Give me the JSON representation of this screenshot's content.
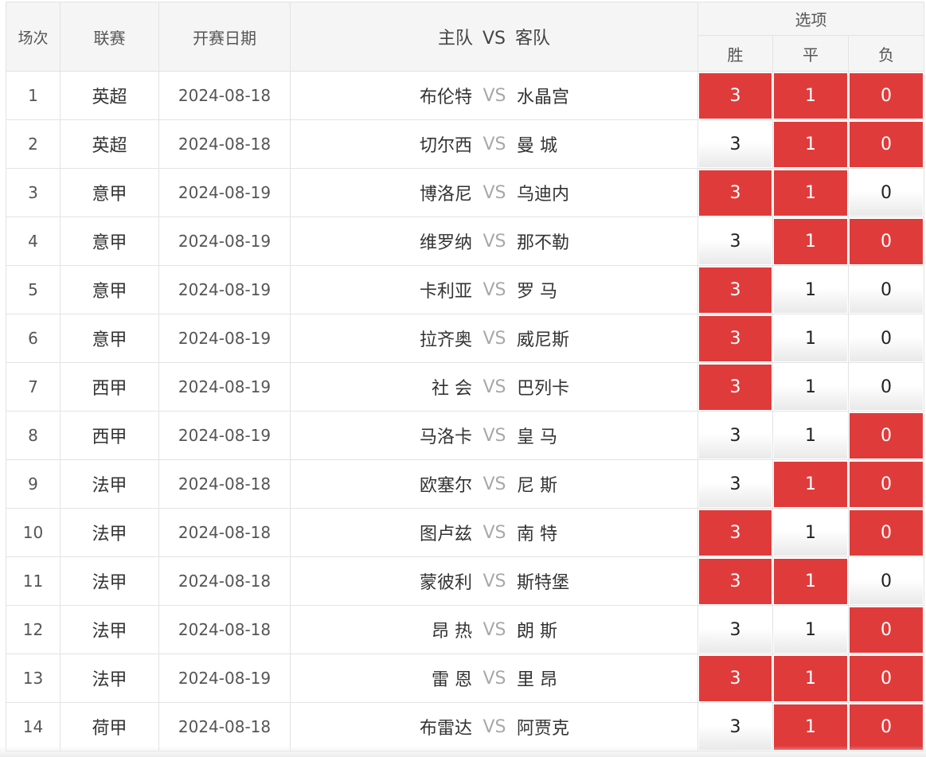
{
  "header": {
    "col_index": "场次",
    "col_league": "联赛",
    "col_date": "开赛日期",
    "col_home": "主队",
    "col_vs": "VS",
    "col_away": "客队",
    "col_options": "选项",
    "opt_win": "胜",
    "opt_draw": "平",
    "opt_lose": "负"
  },
  "colors": {
    "selected": "#e03b3b",
    "vs_text": "#a8a8a8"
  },
  "rows": [
    {
      "no": "1",
      "league": "英超",
      "date": "2024-08-18",
      "home": "布伦特",
      "vs": "VS",
      "away": "水晶宫",
      "win": {
        "label": "3",
        "selected": true
      },
      "draw": {
        "label": "1",
        "selected": true
      },
      "lose": {
        "label": "0",
        "selected": true
      }
    },
    {
      "no": "2",
      "league": "英超",
      "date": "2024-08-18",
      "home": "切尔西",
      "vs": "VS",
      "away": "曼 城",
      "win": {
        "label": "3",
        "selected": false
      },
      "draw": {
        "label": "1",
        "selected": true
      },
      "lose": {
        "label": "0",
        "selected": true
      }
    },
    {
      "no": "3",
      "league": "意甲",
      "date": "2024-08-19",
      "home": "博洛尼",
      "vs": "VS",
      "away": "乌迪内",
      "win": {
        "label": "3",
        "selected": true
      },
      "draw": {
        "label": "1",
        "selected": true
      },
      "lose": {
        "label": "0",
        "selected": false
      }
    },
    {
      "no": "4",
      "league": "意甲",
      "date": "2024-08-19",
      "home": "维罗纳",
      "vs": "VS",
      "away": "那不勒",
      "win": {
        "label": "3",
        "selected": false
      },
      "draw": {
        "label": "1",
        "selected": true
      },
      "lose": {
        "label": "0",
        "selected": true
      }
    },
    {
      "no": "5",
      "league": "意甲",
      "date": "2024-08-19",
      "home": "卡利亚",
      "vs": "VS",
      "away": "罗 马",
      "win": {
        "label": "3",
        "selected": true
      },
      "draw": {
        "label": "1",
        "selected": false
      },
      "lose": {
        "label": "0",
        "selected": false
      }
    },
    {
      "no": "6",
      "league": "意甲",
      "date": "2024-08-19",
      "home": "拉齐奥",
      "vs": "VS",
      "away": "威尼斯",
      "win": {
        "label": "3",
        "selected": true
      },
      "draw": {
        "label": "1",
        "selected": false
      },
      "lose": {
        "label": "0",
        "selected": false
      }
    },
    {
      "no": "7",
      "league": "西甲",
      "date": "2024-08-19",
      "home": "社 会",
      "vs": "VS",
      "away": "巴列卡",
      "win": {
        "label": "3",
        "selected": true
      },
      "draw": {
        "label": "1",
        "selected": false
      },
      "lose": {
        "label": "0",
        "selected": false
      }
    },
    {
      "no": "8",
      "league": "西甲",
      "date": "2024-08-19",
      "home": "马洛卡",
      "vs": "VS",
      "away": "皇 马",
      "win": {
        "label": "3",
        "selected": false
      },
      "draw": {
        "label": "1",
        "selected": false
      },
      "lose": {
        "label": "0",
        "selected": true
      }
    },
    {
      "no": "9",
      "league": "法甲",
      "date": "2024-08-18",
      "home": "欧塞尔",
      "vs": "VS",
      "away": "尼 斯",
      "win": {
        "label": "3",
        "selected": false
      },
      "draw": {
        "label": "1",
        "selected": true
      },
      "lose": {
        "label": "0",
        "selected": true
      }
    },
    {
      "no": "10",
      "league": "法甲",
      "date": "2024-08-18",
      "home": "图卢兹",
      "vs": "VS",
      "away": "南 特",
      "win": {
        "label": "3",
        "selected": true
      },
      "draw": {
        "label": "1",
        "selected": false
      },
      "lose": {
        "label": "0",
        "selected": true
      }
    },
    {
      "no": "11",
      "league": "法甲",
      "date": "2024-08-18",
      "home": "蒙彼利",
      "vs": "VS",
      "away": "斯特堡",
      "win": {
        "label": "3",
        "selected": true
      },
      "draw": {
        "label": "1",
        "selected": true
      },
      "lose": {
        "label": "0",
        "selected": false
      }
    },
    {
      "no": "12",
      "league": "法甲",
      "date": "2024-08-18",
      "home": "昂 热",
      "vs": "VS",
      "away": "朗 斯",
      "win": {
        "label": "3",
        "selected": false
      },
      "draw": {
        "label": "1",
        "selected": false
      },
      "lose": {
        "label": "0",
        "selected": true
      }
    },
    {
      "no": "13",
      "league": "法甲",
      "date": "2024-08-19",
      "home": "雷 恩",
      "vs": "VS",
      "away": "里 昂",
      "win": {
        "label": "3",
        "selected": true
      },
      "draw": {
        "label": "1",
        "selected": true
      },
      "lose": {
        "label": "0",
        "selected": true
      }
    },
    {
      "no": "14",
      "league": "荷甲",
      "date": "2024-08-18",
      "home": "布雷达",
      "vs": "VS",
      "away": "阿贾克",
      "win": {
        "label": "3",
        "selected": false
      },
      "draw": {
        "label": "1",
        "selected": true
      },
      "lose": {
        "label": "0",
        "selected": true
      }
    }
  ]
}
